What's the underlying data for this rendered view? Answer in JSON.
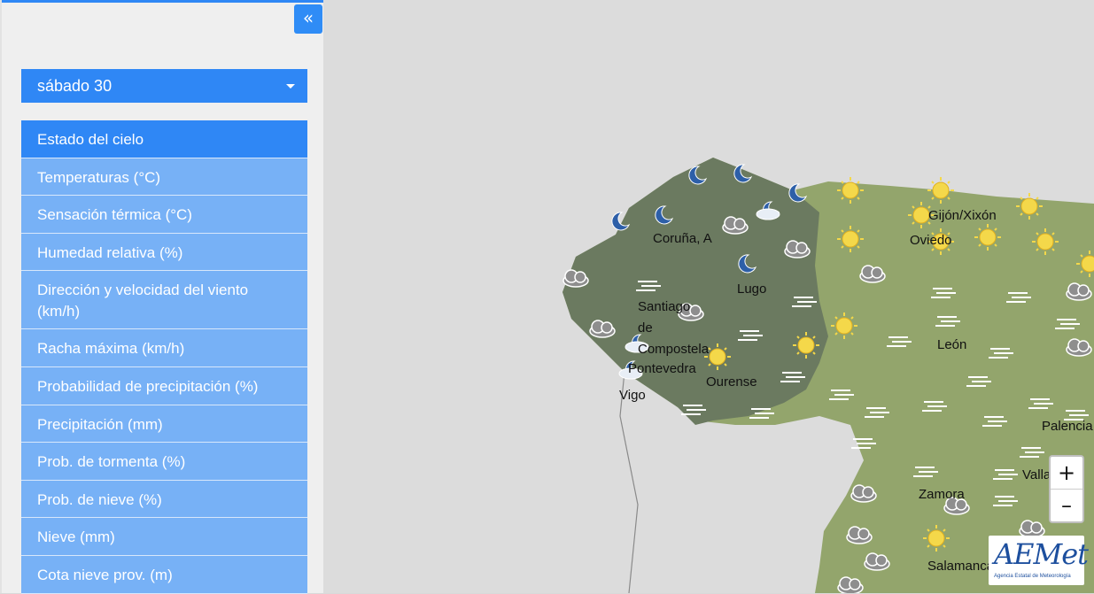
{
  "sidebar": {
    "collapse_label": "«",
    "day_select": {
      "value": "sábado 30"
    },
    "menu": [
      {
        "label": "Estado del cielo"
      },
      {
        "label": "Temperaturas (°C)"
      },
      {
        "label": "Sensación térmica (°C)"
      },
      {
        "label": "Humedad relativa (%)"
      },
      {
        "label": "Dirección y velocidad del viento (km/h)"
      },
      {
        "label": "Racha máxima (km/h)"
      },
      {
        "label": "Probabilidad de precipitación (%)"
      },
      {
        "label": "Precipitación (mm)"
      },
      {
        "label": "Prob. de tormenta (%)"
      },
      {
        "label": "Prob. de nieve (%)"
      },
      {
        "label": "Nieve (mm)"
      },
      {
        "label": "Cota nieve prov. (m)"
      }
    ]
  },
  "map": {
    "cities": [
      "Coruña, A",
      "Lugo",
      "Santiago",
      "de",
      "Compostela",
      "Pontevedra",
      "Ourense",
      "Vigo",
      "Gijón/Xixón",
      "Oviedo",
      "León",
      "Palencia",
      "Zamora",
      "Valla",
      "Salamanca"
    ],
    "zoom_in": "+",
    "zoom_out": "–",
    "logo_text": "AEMet",
    "logo_subtitle": "Agencia Estatal de Meteorología",
    "colors": {
      "galicia": "#6b7a60",
      "land": "#93a56c",
      "sea": "#dcdcdc",
      "sun": "#f4d84a",
      "moon": "#2d5fa8",
      "cloud": "#8a8a8a"
    }
  }
}
